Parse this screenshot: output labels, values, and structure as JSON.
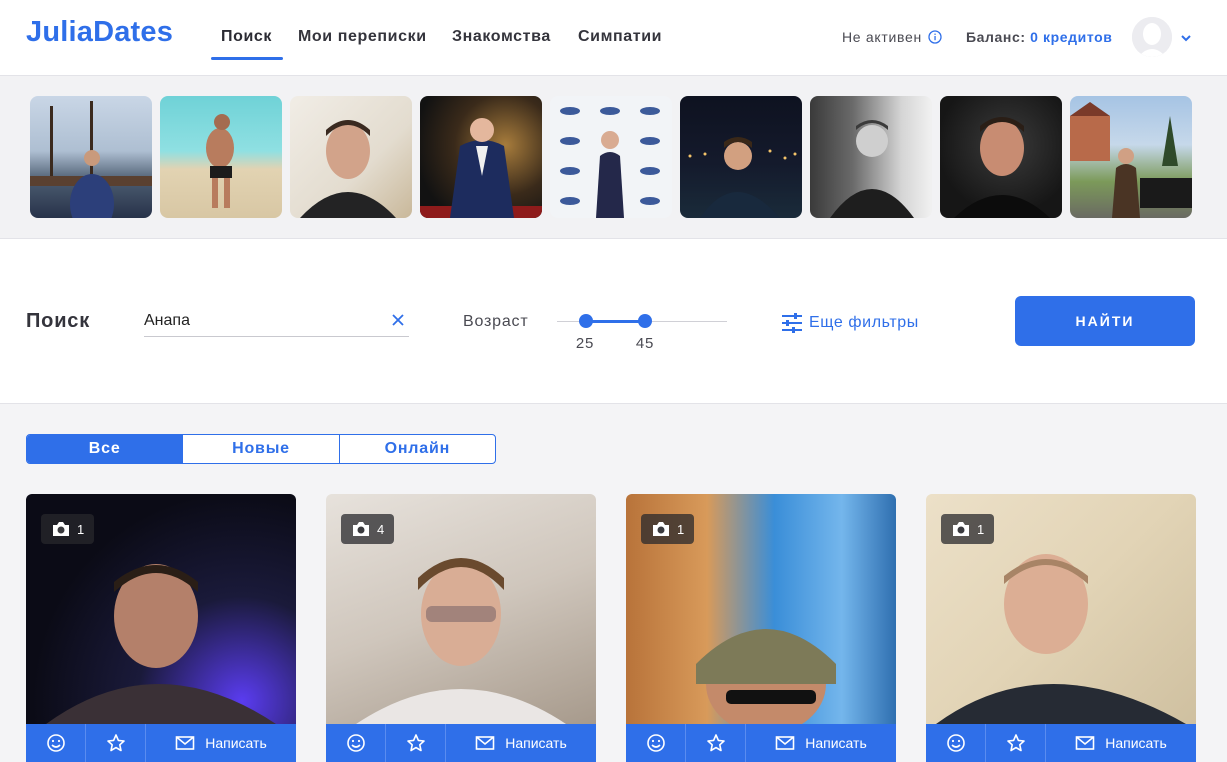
{
  "header": {
    "logo": "JuliaDates",
    "nav": [
      {
        "label": "Поиск",
        "active": true
      },
      {
        "label": "Мои переписки",
        "active": false
      },
      {
        "label": "Знакомства",
        "active": false
      },
      {
        "label": "Симпатии",
        "active": false
      }
    ],
    "status_label": "Не активен",
    "balance_label": "Баланс:",
    "balance_value": "0 кредитов",
    "icons": {
      "status_info": "info-icon",
      "account_menu": "chevron-down-icon",
      "avatar": "user-avatar-icon"
    }
  },
  "colors": {
    "accent": "#2f6fe9",
    "header_bg": "#ffffff",
    "page_bg": "#f4f4f6"
  },
  "search": {
    "title": "Поиск",
    "city_value": "Анапа",
    "age_label": "Возраст",
    "age_min": "25",
    "age_max": "45",
    "more_filters": "Еще фильтры",
    "find_button": "НАЙТИ"
  },
  "tabs": [
    {
      "label": "Все",
      "active": true
    },
    {
      "label": "Новые",
      "active": false
    },
    {
      "label": "Онлайн",
      "active": false
    }
  ],
  "cards": [
    {
      "photo_count": "1",
      "write_label": "Написать"
    },
    {
      "photo_count": "4",
      "write_label": "Написать"
    },
    {
      "photo_count": "1",
      "write_label": "Написать"
    },
    {
      "photo_count": "1",
      "write_label": "Написать"
    }
  ]
}
